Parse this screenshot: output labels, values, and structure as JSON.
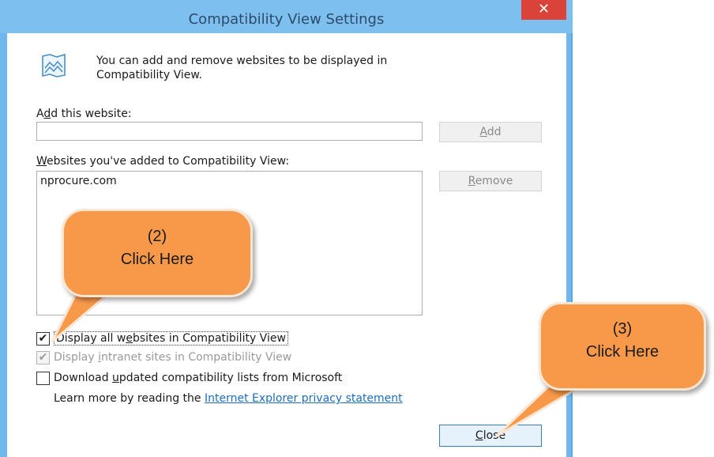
{
  "window": {
    "title": "Compatibility View Settings",
    "close_glyph": "✕"
  },
  "intro": {
    "line1": "You can add and remove websites to be displayed in",
    "line2": "Compatibility View.",
    "icon": "compatibility-view-icon"
  },
  "add_section": {
    "label_prefix": "A",
    "label_mnemonic": "d",
    "label_rest": "d this website:",
    "input_value": "",
    "add_button": {
      "mnemonic": "A",
      "rest": "dd"
    }
  },
  "list_section": {
    "label_mnemonic": "W",
    "label_rest": "ebsites you've added to Compatibility View:",
    "items": [
      "nprocure.com"
    ],
    "remove_button": {
      "mnemonic": "R",
      "rest": "emove"
    }
  },
  "options": {
    "display_all": {
      "pre": "Display all w",
      "mnemonic": "e",
      "post": "bsites in Compatibility View",
      "checked": true
    },
    "intranet": {
      "pre": "Display ",
      "mnemonic": "i",
      "post": "ntranet sites in Compatibility View",
      "checked": true,
      "disabled": true
    },
    "download": {
      "pre": "Download ",
      "mnemonic": "u",
      "post": "pdated compatibility lists from Microsoft",
      "checked": false
    }
  },
  "learn_more": {
    "text": "Learn more by reading the ",
    "link": "Internet Explorer privacy statement"
  },
  "close_button": {
    "mnemonic": "C",
    "rest": "lose"
  },
  "callouts": [
    {
      "line1": "(2)",
      "line2": "Click Here"
    },
    {
      "line1": "(3)",
      "line2": "Click Here"
    }
  ],
  "colors": {
    "titlebar": "#7dc0f0",
    "close_red": "#d9433a",
    "callout_orange": "#f8994a",
    "link_blue": "#1e6ebd"
  }
}
